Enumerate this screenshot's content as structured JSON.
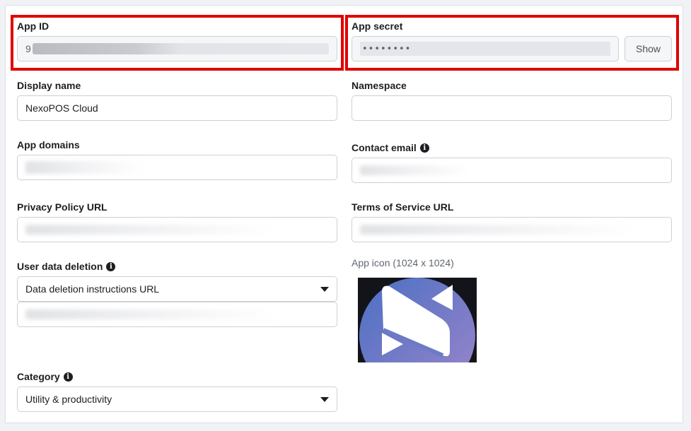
{
  "app_id": {
    "label": "App ID",
    "value": "9"
  },
  "app_secret": {
    "label": "App secret",
    "value": "••••••••",
    "show_label": "Show"
  },
  "display_name": {
    "label": "Display name",
    "value": "NexoPOS Cloud"
  },
  "namespace": {
    "label": "Namespace",
    "value": ""
  },
  "app_domains": {
    "label": "App domains"
  },
  "contact_email": {
    "label": "Contact email"
  },
  "privacy_policy": {
    "label": "Privacy Policy URL"
  },
  "terms_of_service": {
    "label": "Terms of Service URL"
  },
  "user_data_deletion": {
    "label": "User data deletion",
    "selected": "Data deletion instructions URL"
  },
  "app_icon": {
    "label": "App icon (1024 x 1024)"
  },
  "category": {
    "label": "Category",
    "selected": "Utility & productivity"
  },
  "colors": {
    "highlight": "#e00000",
    "icon_circle": "#7a83c6",
    "icon_bg": "#13141a"
  }
}
